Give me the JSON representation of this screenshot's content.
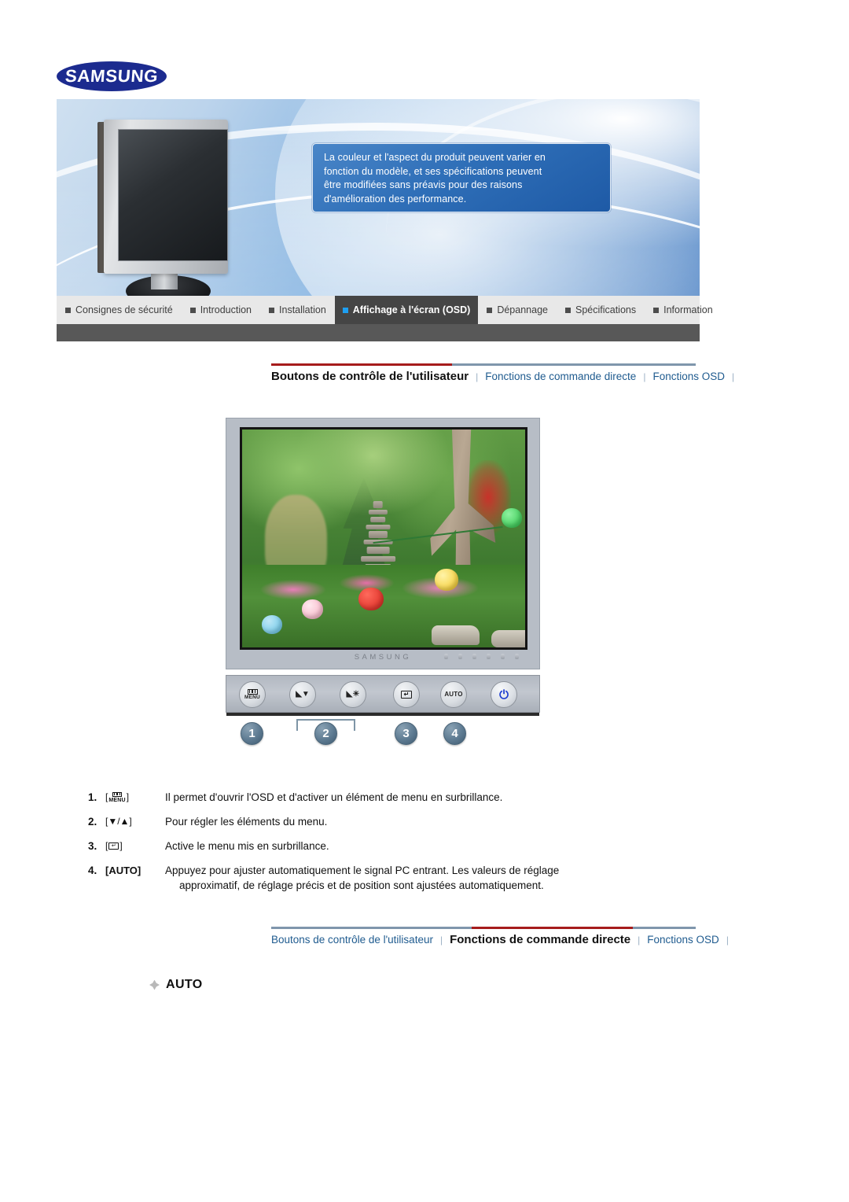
{
  "brand": {
    "logo_text": "SAMSUNG"
  },
  "hero": {
    "notice_lines": [
      "La couleur et l'aspect du produit peuvent varier en",
      "fonction du modèle, et ses spécifications peuvent",
      "être modifiées sans préavis pour des raisons",
      "d'amélioration des performance."
    ]
  },
  "main_nav": {
    "items": [
      {
        "label": "Consignes de sécurité",
        "active": false
      },
      {
        "label": "Introduction",
        "active": false
      },
      {
        "label": "Installation",
        "active": false
      },
      {
        "label": "Affichage à l'écran (OSD)",
        "active": true
      },
      {
        "label": "Dépannage",
        "active": false
      },
      {
        "label": "Spécifications",
        "active": false
      },
      {
        "label": "Information",
        "active": false
      }
    ]
  },
  "sub_nav_top": {
    "items": [
      {
        "label": "Boutons de contrôle de l'utilisateur",
        "active": true
      },
      {
        "label": "Fonctions de commande directe",
        "active": false
      },
      {
        "label": "Fonctions OSD",
        "active": false
      }
    ],
    "separator": "|"
  },
  "sub_nav_bottom": {
    "items": [
      {
        "label": "Boutons de contrôle de l'utilisateur",
        "active": false
      },
      {
        "label": "Fonctions de commande directe",
        "active": true
      },
      {
        "label": "Fonctions OSD",
        "active": false
      }
    ],
    "separator": "|"
  },
  "monitor": {
    "bezel_brand": "SAMSUNG",
    "buttons": [
      {
        "name": "menu-button",
        "label": "MENU",
        "icon": "menu-bars-icon"
      },
      {
        "name": "down-button",
        "label": "",
        "icon": "brightness-down-icon",
        "glyph": "◣▼"
      },
      {
        "name": "up-button",
        "label": "",
        "icon": "brightness-up-icon",
        "glyph": "◣☀"
      },
      {
        "name": "enter-button",
        "label": "",
        "icon": "enter-icon",
        "glyph": "↵"
      },
      {
        "name": "auto-button",
        "label": "AUTO",
        "icon": "auto-text-icon"
      },
      {
        "name": "power-button",
        "label": "",
        "icon": "power-icon",
        "glyph": "⏻"
      }
    ],
    "callouts": [
      "1",
      "2",
      "3",
      "4"
    ]
  },
  "steps": [
    {
      "index": "1.",
      "key_type": "menu",
      "key_label": "MENU",
      "text": "Il permet d'ouvrir l'OSD et d'activer un élément de menu en surbrillance.",
      "text2": ""
    },
    {
      "index": "2.",
      "key_type": "text",
      "key_label": "[▼/▲]",
      "text": "Pour régler les éléments du menu.",
      "text2": ""
    },
    {
      "index": "3.",
      "key_type": "enter",
      "key_label": "↵",
      "text": "Active le menu mis en surbrillance.",
      "text2": ""
    },
    {
      "index": "4.",
      "key_type": "bold",
      "key_label": "[AUTO]",
      "text": "Appuyez pour ajuster automatiquement le signal PC entrant. Les valeurs de réglage",
      "text2": "approximatif, de réglage précis et de position sont ajustées automatiquement."
    }
  ],
  "section": {
    "auto_heading": "AUTO"
  },
  "colors": {
    "brand_blue": "#1c2b8f",
    "accent_red": "#a61c1c",
    "link_blue": "#1f5b8f",
    "tab_active_bg": "#454545",
    "tab_bar_bg": "#e8e8e8",
    "tab_bar_bottom": "#585858",
    "callout_blue": "#5d7a91",
    "power_blue": "#1f3fd0"
  }
}
